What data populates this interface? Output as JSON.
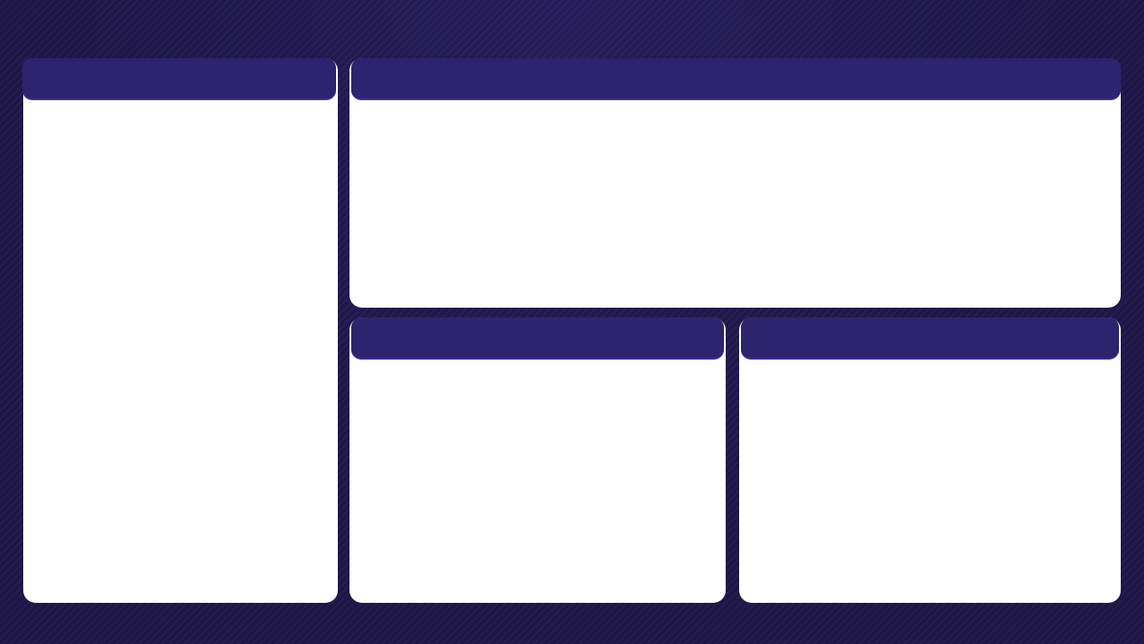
{
  "panels": {
    "left": {
      "title": ""
    },
    "top": {
      "title": ""
    },
    "bottom_left": {
      "title": ""
    },
    "bottom_right": {
      "title": ""
    }
  }
}
